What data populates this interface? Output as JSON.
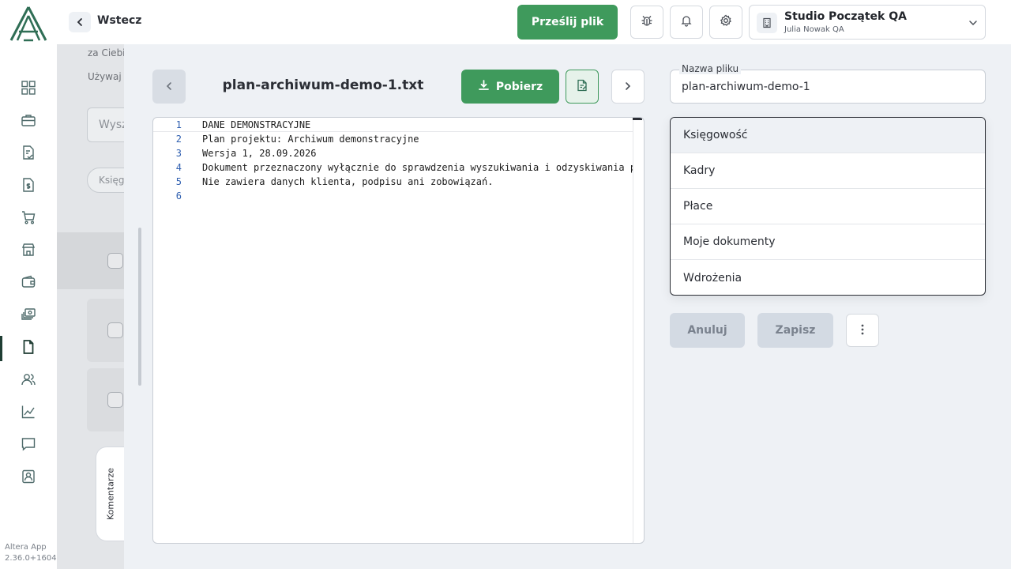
{
  "colors": {
    "accent": "#3f9a5c",
    "sidebar_active": "#1f3d33",
    "panel_bg": "#eef1f5"
  },
  "header": {
    "back_label": "Wstecz",
    "upload_label": "Prześlij plik",
    "org_name": "Studio Początek QA",
    "org_user": "Julia Nowak QA",
    "icons": [
      "bug-icon",
      "bell-icon",
      "gear-icon",
      "building-icon",
      "chevron-down-icon"
    ]
  },
  "sidebar": {
    "items": [
      {
        "icon": "dashboard-icon"
      },
      {
        "icon": "briefcase-icon"
      },
      {
        "icon": "invoice-check-icon"
      },
      {
        "icon": "receipt-dollar-icon"
      },
      {
        "icon": "cart-icon"
      },
      {
        "icon": "store-icon"
      },
      {
        "icon": "wallet-icon"
      },
      {
        "icon": "payments-icon"
      },
      {
        "icon": "document-icon",
        "active": true
      },
      {
        "icon": "users-icon"
      },
      {
        "icon": "chart-icon"
      },
      {
        "icon": "chat-icon"
      },
      {
        "icon": "contact-icon"
      }
    ],
    "version_name": "Altera App",
    "version_number": "2.36.0+1604"
  },
  "background": {
    "line1": "za Ciebie",
    "line2": "Używaj",
    "search_placeholder": "Wysz",
    "chip_label": "Księg"
  },
  "preview": {
    "file_title": "plan-archiwum-demo-1.txt",
    "download_label": "Pobierz",
    "comments_label": "Komentarze",
    "lines": [
      {
        "n": "1",
        "text": "DANE DEMONSTRACYJNE"
      },
      {
        "n": "2",
        "text": "Plan projektu: Archiwum demonstracyjne"
      },
      {
        "n": "3",
        "text": "Wersja 1, 28.09.2026"
      },
      {
        "n": "4",
        "text": "Dokument przeznaczony wyłącznie do sprawdzenia wyszukiwania i odzyskiwania pliku."
      },
      {
        "n": "5",
        "text": "Nie zawiera danych klienta, podpisu ani zobowiązań."
      },
      {
        "n": "6",
        "text": ""
      }
    ]
  },
  "form": {
    "file_name_label": "Nazwa pliku",
    "file_name_value": "plan-archiwum-demo-1",
    "folder_options": [
      "Księgowość",
      "Kadry",
      "Płace",
      "Moje dokumenty",
      "Wdrożenia"
    ],
    "cancel_label": "Anuluj",
    "save_label": "Zapisz"
  }
}
